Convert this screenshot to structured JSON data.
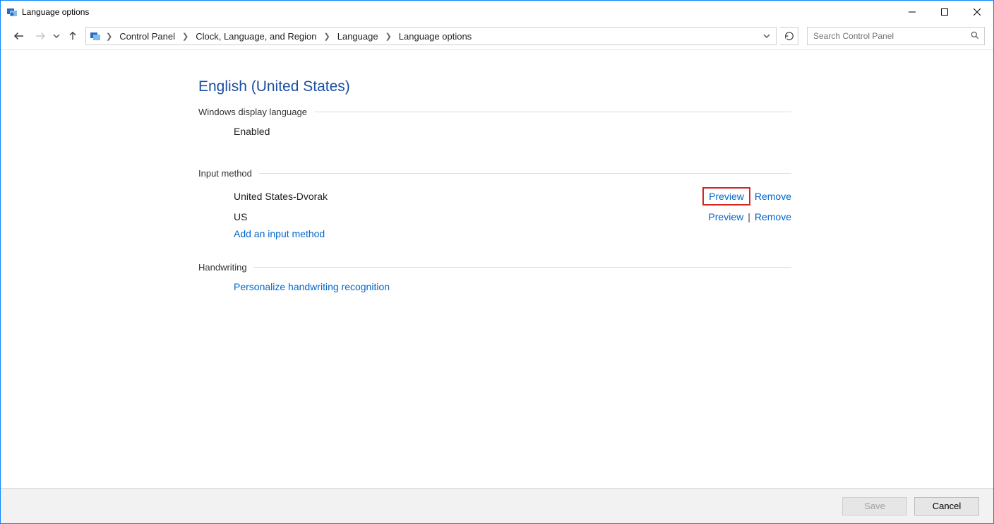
{
  "window": {
    "title": "Language options"
  },
  "breadcrumb": {
    "items": [
      "Control Panel",
      "Clock, Language, and Region",
      "Language",
      "Language options"
    ]
  },
  "search": {
    "placeholder": "Search Control Panel"
  },
  "page": {
    "title": "English (United States)",
    "display_language": {
      "header": "Windows display language",
      "status": "Enabled"
    },
    "input_method": {
      "header": "Input method",
      "methods": [
        {
          "name": "United States-Dvorak",
          "preview": "Preview",
          "remove": "Remove",
          "highlight_preview": true
        },
        {
          "name": "US",
          "preview": "Preview",
          "remove": "Remove",
          "highlight_preview": false
        }
      ],
      "add_link": "Add an input method"
    },
    "handwriting": {
      "header": "Handwriting",
      "personalize_link": "Personalize handwriting recognition"
    }
  },
  "actions": {
    "save": "Save",
    "cancel": "Cancel"
  }
}
